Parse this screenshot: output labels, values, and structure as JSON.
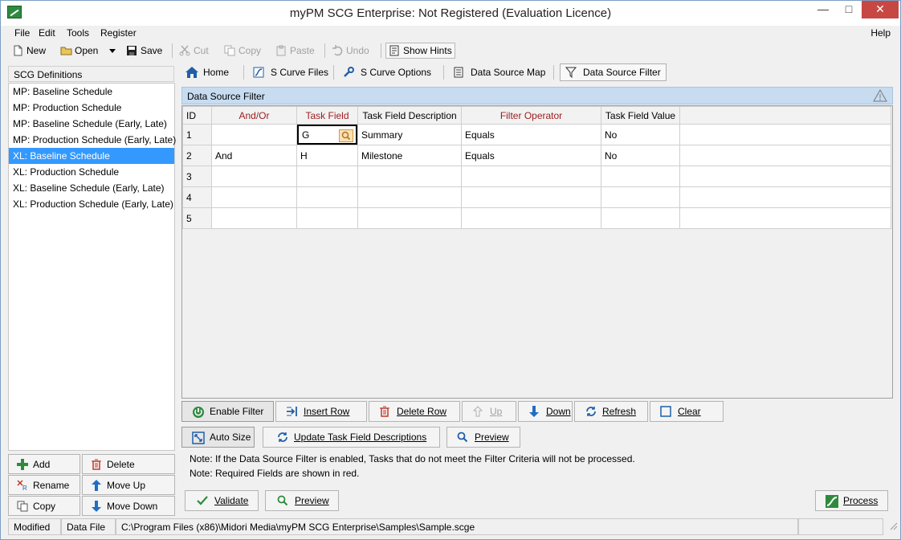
{
  "window": {
    "title": "myPM SCG Enterprise: Not Registered (Evaluation Licence)",
    "app_icon_text": "SCGE",
    "minimize_glyph": "—",
    "maximize_glyph": "□",
    "close_glyph": "✕"
  },
  "menu": {
    "file": "File",
    "edit": "Edit",
    "tools": "Tools",
    "register": "Register",
    "help": "Help"
  },
  "toolbar": {
    "new": "New",
    "open": "Open",
    "save": "Save",
    "cut": "Cut",
    "copy": "Copy",
    "paste": "Paste",
    "undo": "Undo",
    "show_hints": "Show Hints"
  },
  "left_panel": {
    "header": "SCG Definitions",
    "items": [
      {
        "label": "MP: Baseline Schedule",
        "selected": false
      },
      {
        "label": "MP: Production Schedule",
        "selected": false
      },
      {
        "label": "MP: Baseline Schedule (Early, Late)",
        "selected": false
      },
      {
        "label": "MP: Production Schedule (Early, Late)",
        "selected": false
      },
      {
        "label": "XL: Baseline Schedule",
        "selected": true
      },
      {
        "label": "XL: Production Schedule",
        "selected": false
      },
      {
        "label": "XL: Baseline Schedule (Early, Late)",
        "selected": false
      },
      {
        "label": "XL: Production Schedule (Early, Late)",
        "selected": false
      }
    ],
    "buttons": {
      "add": "Add",
      "delete": "Delete",
      "rename": "Rename",
      "move_up": "Move Up",
      "copy": "Copy",
      "move_down": "Move Down"
    }
  },
  "tabs": {
    "home": "Home",
    "s_curve_files": "S Curve Files",
    "s_curve_options": "S Curve Options",
    "data_source_map": "Data Source Map",
    "data_source_filter": "Data Source Filter",
    "active": "Data Source Filter"
  },
  "filter_section": {
    "header": "Data Source Filter",
    "columns": {
      "id": "ID",
      "and_or": "And/Or",
      "task_field": "Task Field",
      "task_field_description": "Task Field Description",
      "filter_operator": "Filter Operator",
      "task_field_value": "Task Field Value"
    },
    "rows": [
      {
        "id": "1",
        "and_or": "",
        "task_field": "G",
        "description": "Summary",
        "operator": "Equals",
        "value": "No"
      },
      {
        "id": "2",
        "and_or": "And",
        "task_field": "H",
        "description": "Milestone",
        "operator": "Equals",
        "value": "No"
      },
      {
        "id": "3",
        "and_or": "",
        "task_field": "",
        "description": "",
        "operator": "",
        "value": ""
      },
      {
        "id": "4",
        "and_or": "",
        "task_field": "",
        "description": "",
        "operator": "",
        "value": ""
      },
      {
        "id": "5",
        "and_or": "",
        "task_field": "",
        "description": "",
        "operator": "",
        "value": ""
      }
    ]
  },
  "grid_buttons": {
    "enable_filter": "Enable Filter",
    "insert_row": "Insert Row",
    "delete_row": "Delete Row",
    "up": "Up",
    "down": "Down",
    "refresh": "Refresh",
    "clear": "Clear"
  },
  "secondary_buttons": {
    "auto_size": "Auto Size",
    "update_descriptions": "Update Task Field Descriptions",
    "preview": "Preview"
  },
  "notes": {
    "note1": "Note: If the Data Source Filter is enabled, Tasks that do not meet the Filter Criteria will not be processed.",
    "note2": "Note: Required Fields are shown in red."
  },
  "bottom_buttons": {
    "validate": "Validate",
    "preview": "Preview",
    "process": "Process"
  },
  "status_bar": {
    "modified": "Modified",
    "data_file_label": "Data File",
    "path": "C:\\Program Files (x86)\\Midori Media\\myPM SCG Enterprise\\Samples\\Sample.scge"
  },
  "colors": {
    "selection": "#3399ff",
    "section_header": "#c7dcf0",
    "required_field_text": "#9c1c1c",
    "close_button": "#c74843"
  }
}
